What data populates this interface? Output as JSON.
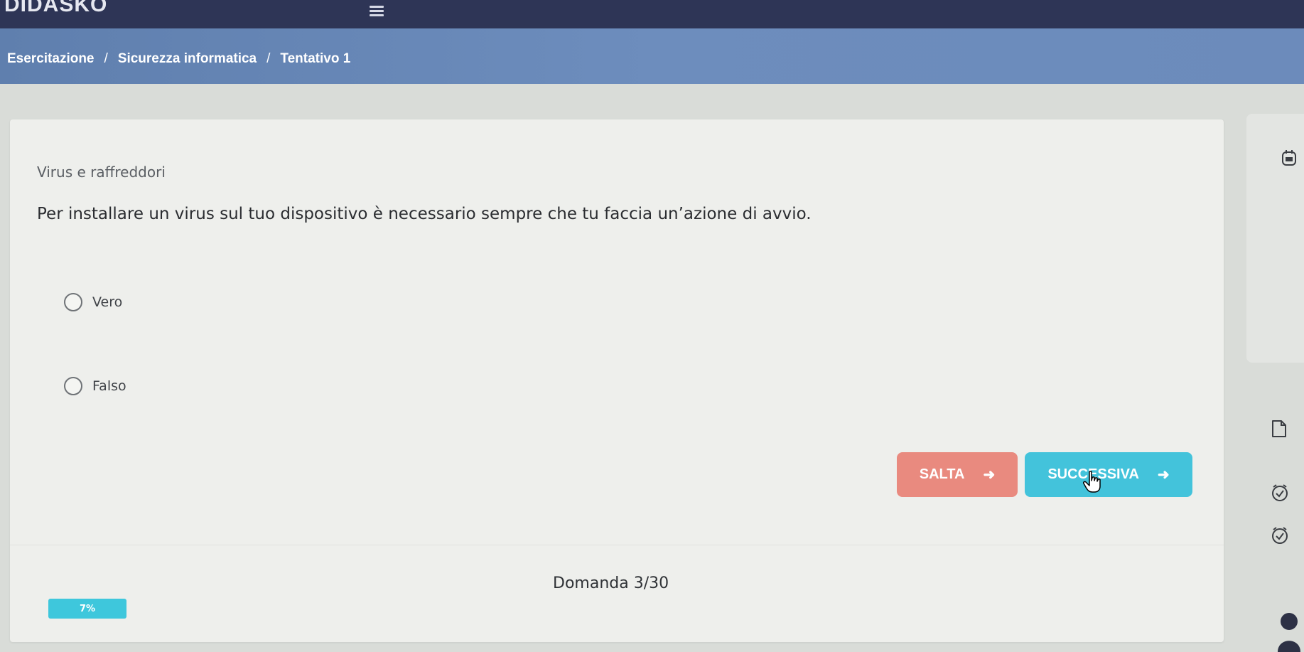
{
  "app": {
    "logo": "DIDASKO"
  },
  "breadcrumb": {
    "items": [
      "Esercitazione",
      "Sicurezza informatica",
      "Tentativo 1"
    ],
    "separator": "/"
  },
  "question": {
    "category": "Virus e raffreddori",
    "text": "Per installare un virus sul tuo dispositivo è necessario sempre che tu faccia un’azione di avvio.",
    "options": [
      {
        "label": "Vero",
        "selected": false
      },
      {
        "label": "Falso",
        "selected": false
      }
    ]
  },
  "actions": {
    "skip_label": "SALTA",
    "next_label": "SUCCESSIVA"
  },
  "footer": {
    "counter": "Domanda 3/30",
    "progress_label": "7%",
    "progress_percent": 7
  },
  "colors": {
    "topbar": "#2e3556",
    "breadcrumb_bar": "#6d8dbd",
    "skip_button": "#e98a7f",
    "next_button": "#43c3db",
    "progress": "#3ec7dc"
  },
  "icons": {
    "menu": "hamburger-menu-icon",
    "side": [
      "calendar-icon",
      "document-icon",
      "timer-icon",
      "timer-icon",
      "user-avatar-icon"
    ]
  }
}
